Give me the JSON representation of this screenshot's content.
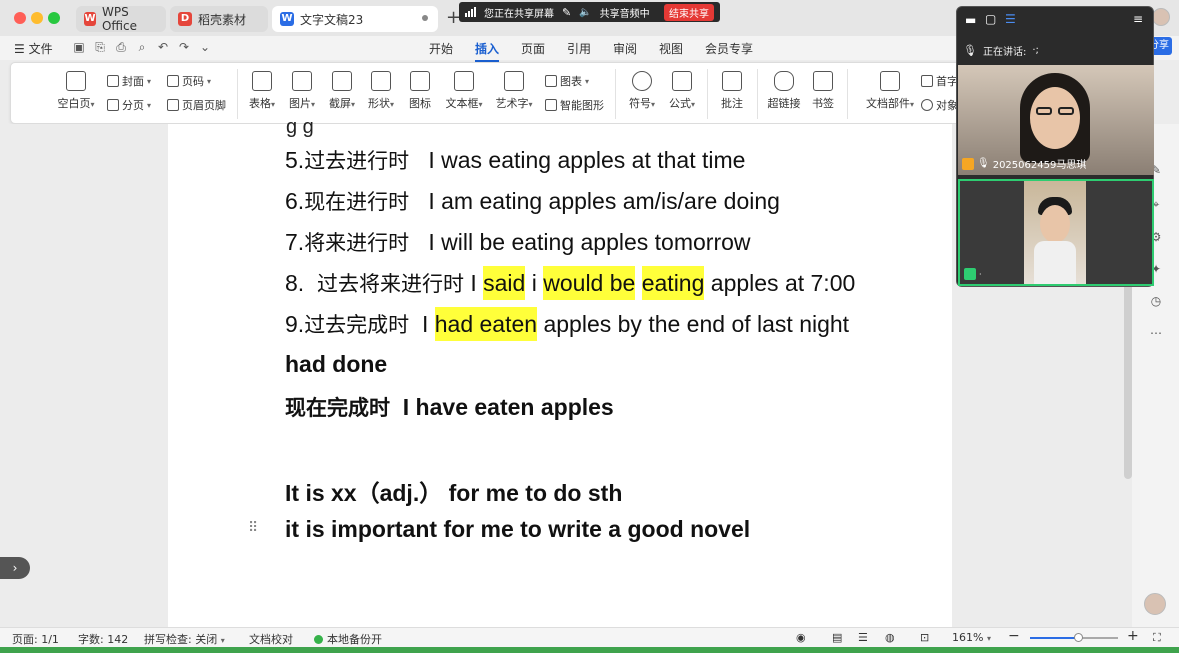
{
  "window": {
    "tabs": [
      {
        "label": "WPS Office"
      },
      {
        "label": "稻壳素材"
      },
      {
        "label": "文字文稿23"
      }
    ]
  },
  "share_bar": {
    "sharing_label": "您正在共享屏幕",
    "audio_label": "共享音频中",
    "end_label": "结束共享"
  },
  "menu": {
    "file_label": "文件",
    "tabs": [
      "开始",
      "插入",
      "页面",
      "引用",
      "审阅",
      "视图",
      "会员专享"
    ],
    "active_tab": "插入",
    "share_btn": "分享"
  },
  "ribbon": {
    "blank_page": "空白页",
    "cover": "封面",
    "section": "分页",
    "page_number": "页码",
    "header_footer": "页眉页脚",
    "table": "表格",
    "picture": "图片",
    "screenshot": "截屏",
    "shapes": "形状",
    "icons": "图标",
    "chart": "图表",
    "smart_graphic": "智能图形",
    "textbox": "文本框",
    "wordart": "艺术字",
    "symbol": "符号",
    "formula": "公式",
    "comment": "批注",
    "hyperlink": "超链接",
    "bookmark": "书签",
    "doc_parts": "文档部件",
    "dropcap": "首字",
    "object": "对象"
  },
  "document": {
    "line5": {
      "num": "5.",
      "cn": "过去进行时",
      "en": "I was eating apples at that time"
    },
    "line6": {
      "num": "6.",
      "cn": "现在进行时",
      "en": "I am eating apples am/is/are doing"
    },
    "line7": {
      "num": "7.",
      "cn": "将来进行时",
      "en": "I will be eating apples tomorrow"
    },
    "line8": {
      "num": "8.",
      "cn": "过去将来进行时",
      "i1": "I",
      "w1": "said",
      "i2": "i",
      "w2": "would be",
      "w3": "eating",
      "rest": "apples at 7:00"
    },
    "line9": {
      "num": "9.",
      "cn": "过去完成时",
      "i": "I",
      "w1": "had eaten",
      "rest": "apples by the end of last night"
    },
    "had_done": "had done",
    "present_perfect": {
      "cn": "现在完成时",
      "en": "I have eaten apples"
    },
    "it_is": "It is xx（adj.）  for me to do sth",
    "example": "it is important for me to write a good novel"
  },
  "call_panel": {
    "speaking_label": "正在讲话:",
    "speaking_suffix": "·;",
    "participant1": "2025062459马思琪"
  },
  "status_bar": {
    "page": "页面: 1/1",
    "words": "字数: 142",
    "spellcheck": "拼写检查: 关闭",
    "proofread": "文档校对",
    "backup": "本地备份开",
    "zoom": "161%"
  },
  "zoom_level_fraction": 0.55,
  "colors": {
    "highlight": "#ffff3a",
    "accent": "#2b6de5",
    "active_speaker": "#2ecc71"
  }
}
